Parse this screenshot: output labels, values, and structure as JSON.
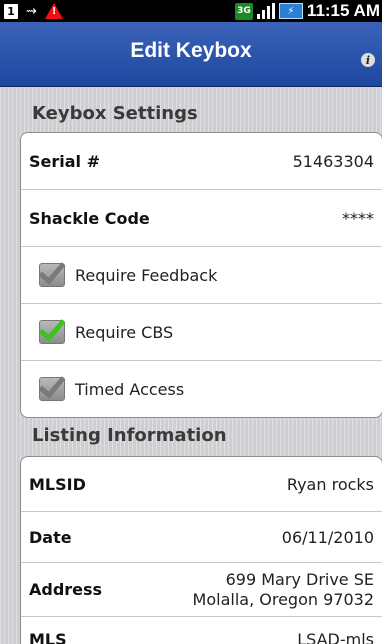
{
  "status_bar": {
    "sim_label": "1",
    "usb_symbol": "⇝",
    "warning_symbol": "!",
    "network_badge": "3G",
    "time": "11:15 AM",
    "icons": [
      "sim-icon",
      "usb-icon",
      "warning-icon",
      "3g-icon",
      "signal-icon",
      "battery-icon"
    ]
  },
  "title_bar": {
    "title": "Edit Keybox",
    "info_symbol": "i"
  },
  "keybox_settings": {
    "header": "Keybox Settings",
    "serial_label": "Serial #",
    "serial_value": "51463304",
    "shackle_label": "Shackle Code",
    "shackle_value": "****",
    "checkboxes": [
      {
        "label": "Require Feedback",
        "checked": true,
        "color": "#7a7a7a"
      },
      {
        "label": "Require CBS",
        "checked": true,
        "color": "#3ec31e"
      },
      {
        "label": "Timed Access",
        "checked": true,
        "color": "#7a7a7a"
      }
    ]
  },
  "listing_information": {
    "header": "Listing Information",
    "rows": [
      {
        "label": "MLSID",
        "value": "Ryan rocks"
      },
      {
        "label": "Date",
        "value": "06/11/2010"
      },
      {
        "label": "Address",
        "value_line1": "699 Mary Drive SE",
        "value_line2": "Molalla, Oregon 97032"
      },
      {
        "label": "MLS",
        "value": "LSAD-mls"
      }
    ]
  },
  "colors": {
    "title_bar": "#2a52a8",
    "background": "#cfcfd3",
    "accent_check": "#3ec31e"
  }
}
